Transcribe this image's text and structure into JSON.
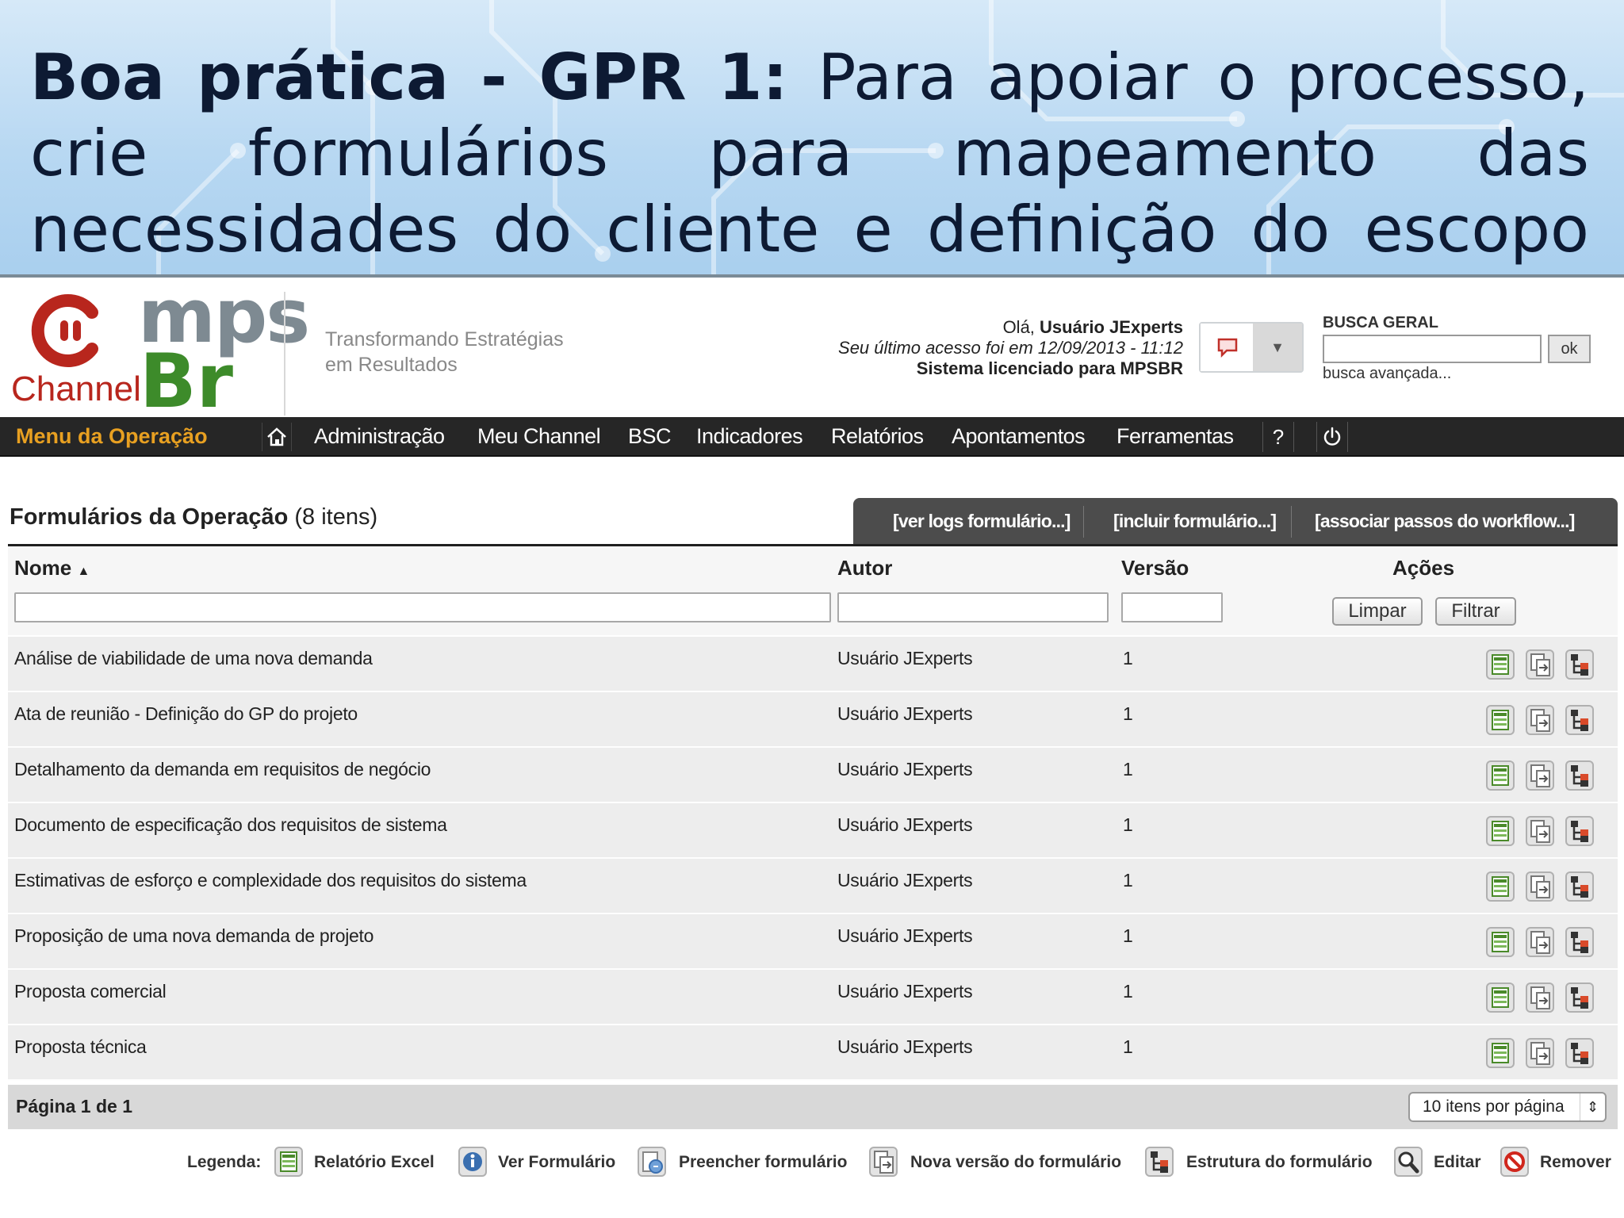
{
  "slide": {
    "title_bold": "Boa prática - GPR 1:",
    "title_rest": " Para apoiar o processo, crie formulários para mapeamento das necessidades do cliente e definição do escopo do projeto"
  },
  "header": {
    "logo_channel": "Channel",
    "logo_mps": "mps",
    "logo_br": "Br",
    "tagline_line1": "Transformando Estratégias",
    "tagline_line2": "em Resultados",
    "greeting_prefix": "Olá, ",
    "user_name": "Usuário JExperts",
    "last_access": "Seu último acesso foi em 12/09/2013 - 11:12",
    "license": "Sistema licenciado para MPSBR",
    "search_label": "BUSCA GERAL",
    "search_ok": "ok",
    "search_advanced": "busca avançada..."
  },
  "nav": {
    "menu_operation": "Menu da Operação",
    "items": [
      "Administração",
      "Meu Channel",
      "BSC",
      "Indicadores",
      "Relatórios",
      "Apontamentos",
      "Ferramentas"
    ],
    "help": "?"
  },
  "section": {
    "title": "Formulários da Operação",
    "count": "(8 itens)",
    "tabs": [
      "[ver logs formulário...]",
      "[incluir formulário...]",
      "[associar passos do workflow...]"
    ]
  },
  "table": {
    "headers": {
      "name": "Nome",
      "sort_indicator": "▲",
      "author": "Autor",
      "version": "Versão",
      "actions": "Ações"
    },
    "buttons": {
      "clear": "Limpar",
      "filter": "Filtrar"
    },
    "rows": [
      {
        "name": "Análise de viabilidade de uma nova demanda",
        "author": "Usuário JExperts",
        "version": "1"
      },
      {
        "name": "Ata de reunião - Definição do GP do projeto",
        "author": "Usuário JExperts",
        "version": "1"
      },
      {
        "name": "Detalhamento da demanda em requisitos de negócio",
        "author": "Usuário JExperts",
        "version": "1"
      },
      {
        "name": "Documento de especificação dos requisitos de sistema",
        "author": "Usuário JExperts",
        "version": "1"
      },
      {
        "name": "Estimativas de esforço e complexidade dos requisitos do sistema",
        "author": "Usuário JExperts",
        "version": "1"
      },
      {
        "name": "Proposição de uma nova demanda de projeto",
        "author": "Usuário JExperts",
        "version": "1"
      },
      {
        "name": "Proposta comercial",
        "author": "Usuário JExperts",
        "version": "1"
      },
      {
        "name": "Proposta técnica",
        "author": "Usuário JExperts",
        "version": "1"
      }
    ],
    "row_action_icons": [
      "excel-report-icon",
      "new-version-icon",
      "form-structure-icon"
    ]
  },
  "pager": {
    "page_label": "Página 1 de 1",
    "per_page": "10 itens por página"
  },
  "legend": {
    "label": "Legenda:",
    "items": [
      {
        "icon": "excel-report-icon",
        "label": "Relatório Excel"
      },
      {
        "icon": "view-form-icon",
        "label": "Ver Formulário"
      },
      {
        "icon": "fill-form-icon",
        "label": "Preencher formulário"
      },
      {
        "icon": "new-version-icon",
        "label": "Nova versão do formulário"
      },
      {
        "icon": "form-structure-icon",
        "label": "Estrutura do formulário"
      },
      {
        "icon": "edit-icon",
        "label": "Editar"
      },
      {
        "icon": "remove-icon",
        "label": "Remover"
      }
    ]
  },
  "colors": {
    "nav_background": "#262626",
    "menu_accent": "#e8a021",
    "logo_red": "#b8261d",
    "logo_green": "#3d8b2a",
    "banner_blue": "#b8d8f2"
  }
}
